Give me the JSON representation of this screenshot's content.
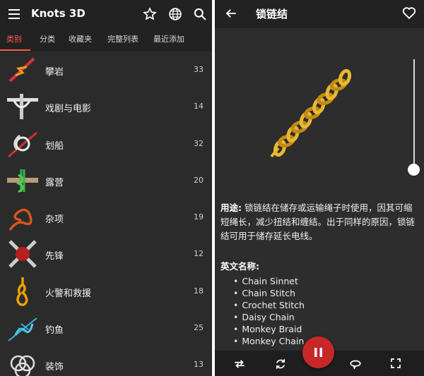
{
  "left": {
    "app_title": "Knots 3D",
    "tabs": [
      "类别",
      "分类",
      "收藏夹",
      "完整列表",
      "最近添加"
    ],
    "active_tab": "类别",
    "categories": [
      {
        "label": "攀岩",
        "count": "33"
      },
      {
        "label": "戏剧与电影",
        "count": "14"
      },
      {
        "label": "划船",
        "count": "32"
      },
      {
        "label": "露营",
        "count": "20"
      },
      {
        "label": "杂项",
        "count": "19"
      },
      {
        "label": "先锋",
        "count": "12"
      },
      {
        "label": "火警和救援",
        "count": "18"
      },
      {
        "label": "钓鱼",
        "count": "25"
      },
      {
        "label": "装饰",
        "count": "13"
      }
    ],
    "icons": [
      "menu-icon",
      "star-icon",
      "globe-icon",
      "search-icon"
    ]
  },
  "right": {
    "title": "锁链结",
    "usage_label": "用途:",
    "usage_text": "锁链结在储存或运输绳子时使用，因其可缩短绳长，减少扭结和缠结。出于同样的原因，锁链结可用于储存延长电线。",
    "names_title": "英文名称:",
    "english_names": [
      "Chain Sinnet",
      "Chain Stitch",
      "Crochet Stitch",
      "Daisy Chain",
      "Monkey Braid",
      "Monkey Chain"
    ],
    "icons": [
      "back-arrow-icon",
      "heart-icon",
      "swap-icon",
      "rotate-icon",
      "pause-icon",
      "loop-icon",
      "fullscreen-icon"
    ],
    "colors": {
      "accent": "#ff5a4a",
      "play_button": "#c62828",
      "rope": "#d9a521"
    }
  }
}
